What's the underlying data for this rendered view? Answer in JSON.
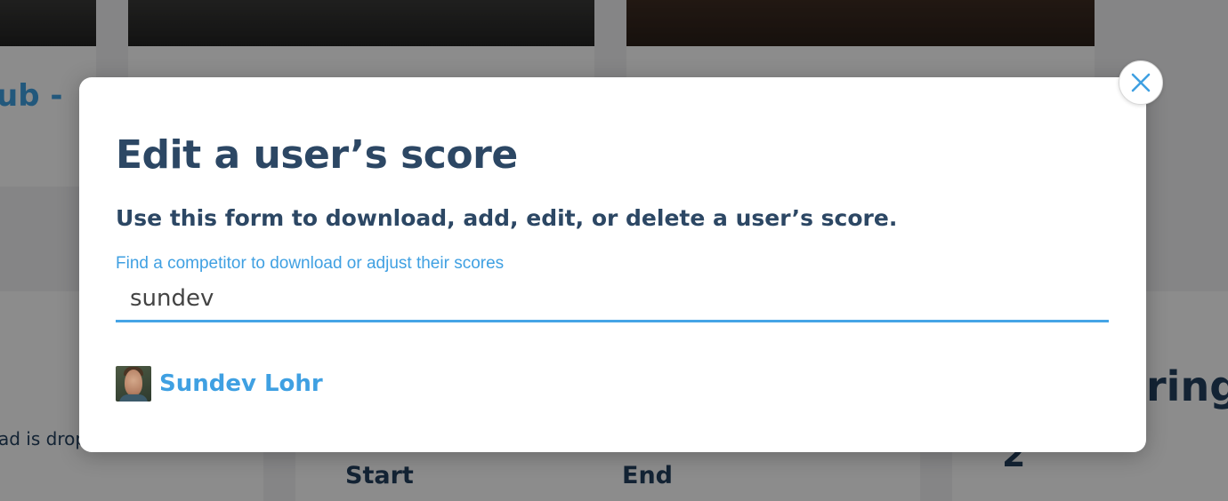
{
  "background": {
    "card_titles": {
      "left_partial": "ub -",
      "right_partial": "ring",
      "right_number": "2",
      "left_body_partial": "ad is drop"
    },
    "schedule": {
      "start_label": "Start",
      "end_label": "End"
    }
  },
  "modal": {
    "title": "Edit a user’s score",
    "subtitle": "Use this form to download, add, edit, or delete a user’s score.",
    "search": {
      "label": "Find a competitor to download or adjust their scores",
      "value": "sundev"
    },
    "results": [
      {
        "name": "Sundev Lohr",
        "avatar": "user-avatar-photo"
      }
    ],
    "close_icon": "close-icon"
  },
  "colors": {
    "heading": "#2c4764",
    "accent": "#3fa0e2",
    "overlay": "rgba(0,0,0,0.45)"
  }
}
